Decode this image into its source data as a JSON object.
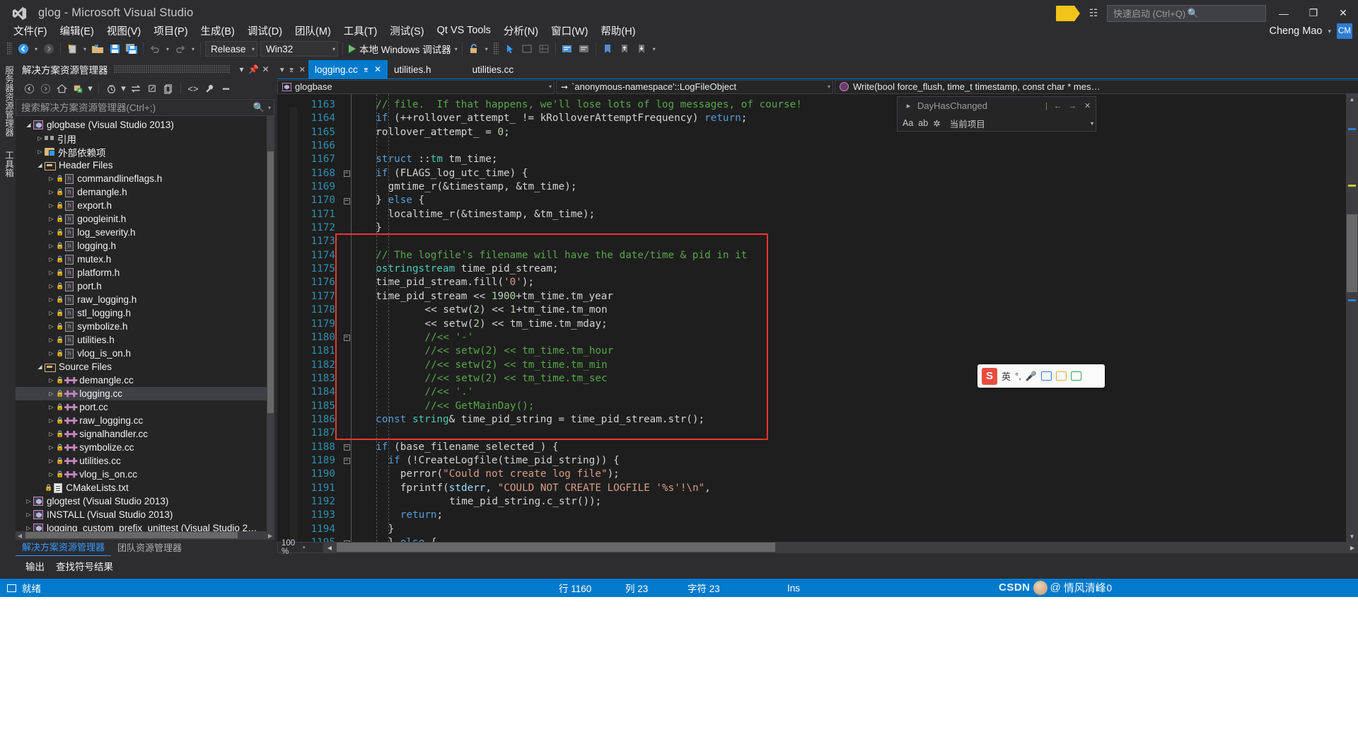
{
  "window": {
    "title": "glog - Microsoft Visual Studio",
    "logo_icon": "visual-studio-logo",
    "minimize_label": "—",
    "maximize_label": "❐",
    "close_label": "✕"
  },
  "titlebar_right": {
    "feedback_icon": "feedback-flag-icon",
    "notify_icon": "notification-icon",
    "quick_launch_placeholder": "快速启动 (Ctrl+Q)",
    "search_icon": "search-icon"
  },
  "menu": {
    "items": [
      "文件(F)",
      "编辑(E)",
      "视图(V)",
      "项目(P)",
      "生成(B)",
      "调试(D)",
      "团队(M)",
      "工具(T)",
      "测试(S)",
      "Qt VS Tools",
      "分析(N)",
      "窗口(W)",
      "帮助(H)"
    ],
    "user_name": "Cheng Mao",
    "user_initials": "CM",
    "user_caret": "▾"
  },
  "toolbar": {
    "nav_back_icon": "navigate-back-icon",
    "nav_forward_icon": "navigate-forward-icon",
    "new_project_icon": "new-project-icon",
    "open_file_icon": "open-file-icon",
    "save_icon": "save-icon",
    "save_all_icon": "save-all-icon",
    "undo_icon": "undo-icon",
    "redo_icon": "redo-icon",
    "configuration": "Release",
    "platform": "Win32",
    "run_label": "本地 Windows 调试器",
    "run_icon": "play-icon",
    "caret": "▾"
  },
  "vertical_tabs": [
    "服务器资源管理器",
    "工具箱"
  ],
  "solution_explorer": {
    "title": "解决方案资源管理器",
    "pin_icon": "pin-icon",
    "close_icon": "close-icon",
    "dropdown_icon": "chevron-down-icon",
    "toolbar_icons": [
      "back-icon",
      "forward-icon",
      "home-icon",
      "show-all-files-icon",
      "pending-changes-icon",
      "sync-icon",
      "collapse-all-icon",
      "properties-icon",
      "view-code-icon",
      "properties-wrench-icon",
      "preview-icon"
    ],
    "search_placeholder": "搜索解决方案资源管理器(Ctrl+;)",
    "search_icon": "search-icon",
    "tree": [
      {
        "depth": 0,
        "arrow": "expanded",
        "icon": "project-icon",
        "lock": false,
        "label": "glogbase (Visual Studio 2013)",
        "selected": false
      },
      {
        "depth": 1,
        "arrow": "collapsed",
        "icon": "references-icon",
        "lock": false,
        "label": "引用",
        "selected": false
      },
      {
        "depth": 1,
        "arrow": "collapsed",
        "icon": "external-deps-icon",
        "lock": false,
        "label": "外部依赖项",
        "selected": false
      },
      {
        "depth": 1,
        "arrow": "expanded",
        "icon": "filter-folder-icon",
        "lock": false,
        "label": "Header Files",
        "selected": false
      },
      {
        "depth": 2,
        "arrow": "collapsed",
        "icon": "header-file-icon",
        "lock": true,
        "label": "commandlineflags.h",
        "selected": false
      },
      {
        "depth": 2,
        "arrow": "collapsed",
        "icon": "header-file-icon",
        "lock": true,
        "label": "demangle.h",
        "selected": false
      },
      {
        "depth": 2,
        "arrow": "collapsed",
        "icon": "header-file-icon",
        "lock": true,
        "label": "export.h",
        "selected": false
      },
      {
        "depth": 2,
        "arrow": "collapsed",
        "icon": "header-file-icon",
        "lock": true,
        "label": "googleinit.h",
        "selected": false
      },
      {
        "depth": 2,
        "arrow": "collapsed",
        "icon": "header-file-icon",
        "lock": true,
        "label": "log_severity.h",
        "selected": false
      },
      {
        "depth": 2,
        "arrow": "collapsed",
        "icon": "header-file-icon",
        "lock": true,
        "label": "logging.h",
        "selected": false
      },
      {
        "depth": 2,
        "arrow": "collapsed",
        "icon": "header-file-icon",
        "lock": true,
        "label": "mutex.h",
        "selected": false
      },
      {
        "depth": 2,
        "arrow": "collapsed",
        "icon": "header-file-icon",
        "lock": true,
        "label": "platform.h",
        "selected": false
      },
      {
        "depth": 2,
        "arrow": "collapsed",
        "icon": "header-file-icon",
        "lock": true,
        "label": "port.h",
        "selected": false
      },
      {
        "depth": 2,
        "arrow": "collapsed",
        "icon": "header-file-icon",
        "lock": true,
        "label": "raw_logging.h",
        "selected": false
      },
      {
        "depth": 2,
        "arrow": "collapsed",
        "icon": "header-file-icon",
        "lock": true,
        "label": "stl_logging.h",
        "selected": false
      },
      {
        "depth": 2,
        "arrow": "collapsed",
        "icon": "header-file-icon",
        "lock": true,
        "label": "symbolize.h",
        "selected": false
      },
      {
        "depth": 2,
        "arrow": "collapsed",
        "icon": "header-file-icon",
        "lock": true,
        "label": "utilities.h",
        "selected": false
      },
      {
        "depth": 2,
        "arrow": "collapsed",
        "icon": "header-file-icon",
        "lock": true,
        "label": "vlog_is_on.h",
        "selected": false
      },
      {
        "depth": 1,
        "arrow": "expanded",
        "icon": "filter-folder-icon",
        "lock": false,
        "label": "Source Files",
        "selected": false
      },
      {
        "depth": 2,
        "arrow": "collapsed",
        "icon": "cpp-file-icon",
        "lock": true,
        "label": "demangle.cc",
        "selected": false
      },
      {
        "depth": 2,
        "arrow": "collapsed",
        "icon": "cpp-file-icon",
        "lock": true,
        "label": "logging.cc",
        "selected": true
      },
      {
        "depth": 2,
        "arrow": "collapsed",
        "icon": "cpp-file-icon",
        "lock": true,
        "label": "port.cc",
        "selected": false
      },
      {
        "depth": 2,
        "arrow": "collapsed",
        "icon": "cpp-file-icon",
        "lock": true,
        "label": "raw_logging.cc",
        "selected": false
      },
      {
        "depth": 2,
        "arrow": "collapsed",
        "icon": "cpp-file-icon",
        "lock": true,
        "label": "signalhandler.cc",
        "selected": false
      },
      {
        "depth": 2,
        "arrow": "collapsed",
        "icon": "cpp-file-icon",
        "lock": true,
        "label": "symbolize.cc",
        "selected": false
      },
      {
        "depth": 2,
        "arrow": "collapsed",
        "icon": "cpp-file-icon",
        "lock": true,
        "label": "utilities.cc",
        "selected": false
      },
      {
        "depth": 2,
        "arrow": "collapsed",
        "icon": "cpp-file-icon",
        "lock": true,
        "label": "vlog_is_on.cc",
        "selected": false
      },
      {
        "depth": 1,
        "arrow": "none",
        "icon": "text-file-icon",
        "lock": true,
        "label": "CMakeLists.txt",
        "selected": false
      },
      {
        "depth": 0,
        "arrow": "collapsed",
        "icon": "project-icon",
        "lock": false,
        "label": "glogtest (Visual Studio 2013)",
        "selected": false
      },
      {
        "depth": 0,
        "arrow": "collapsed",
        "icon": "project-icon",
        "lock": false,
        "label": "INSTALL (Visual Studio 2013)",
        "selected": false
      },
      {
        "depth": 0,
        "arrow": "collapsed",
        "icon": "project-icon",
        "lock": false,
        "label": "logging_custom_prefix_unittest (Visual Studio 2…",
        "selected": false
      }
    ],
    "panel_tabs": [
      {
        "label": "解决方案资源管理器",
        "active": true
      },
      {
        "label": "团队资源管理器",
        "active": false
      }
    ]
  },
  "editor": {
    "tabs": [
      {
        "label": "logging.cc",
        "active": true,
        "pin_icon": "pin-icon",
        "close_icon": "close-icon"
      },
      {
        "label": "utilities.h",
        "active": false
      },
      {
        "label": "utilities.cc",
        "active": false
      }
    ],
    "navbar": {
      "project": "glogbase",
      "project_icon": "project-icon",
      "scope": "`anonymous-namespace'::LogFileObject",
      "scope_arrow_icon": "arrow-right-icon",
      "member": "Write(bool force_flush, time_t timestamp, const char * mes…",
      "member_icon": "method-icon",
      "caret": "▾"
    },
    "zoom": "100 %",
    "zoom_caret": "▾",
    "first_line": 1163,
    "lines": [
      {
        "n": 1163,
        "fold": "",
        "indent": 1,
        "tokens": [
          [
            "c",
            "// file.  If that happens, we'll lose lots of log messages, of course!"
          ]
        ]
      },
      {
        "n": 1164,
        "fold": "",
        "indent": 1,
        "tokens": [
          [
            "k",
            "if"
          ],
          [
            "p",
            " (++rollover_attempt_ != kRolloverAttemptFrequency) "
          ],
          [
            "k",
            "return"
          ],
          [
            "p",
            ";"
          ]
        ]
      },
      {
        "n": 1165,
        "fold": "",
        "indent": 1,
        "tokens": [
          [
            "p",
            "rollover_attempt_ = "
          ],
          [
            "n",
            "0"
          ],
          [
            "p",
            ";"
          ]
        ]
      },
      {
        "n": 1166,
        "fold": "",
        "indent": 1,
        "tokens": []
      },
      {
        "n": 1167,
        "fold": "",
        "indent": 1,
        "tokens": [
          [
            "k",
            "struct"
          ],
          [
            "p",
            " ::"
          ],
          [
            "t",
            "tm"
          ],
          [
            "p",
            " tm_time;"
          ]
        ]
      },
      {
        "n": 1168,
        "fold": "minus",
        "indent": 1,
        "tokens": [
          [
            "k",
            "if"
          ],
          [
            "p",
            " (FLAGS_log_utc_time) {"
          ]
        ]
      },
      {
        "n": 1169,
        "fold": "",
        "indent": 2,
        "tokens": [
          [
            "p",
            "gmtime_r(&timestamp, &tm_time);"
          ]
        ]
      },
      {
        "n": 1170,
        "fold": "minus",
        "indent": 1,
        "tokens": [
          [
            "p",
            "} "
          ],
          [
            "k",
            "else"
          ],
          [
            "p",
            " {"
          ]
        ]
      },
      {
        "n": 1171,
        "fold": "",
        "indent": 2,
        "tokens": [
          [
            "p",
            "localtime_r(&timestamp, &tm_time);"
          ]
        ]
      },
      {
        "n": 1172,
        "fold": "",
        "indent": 1,
        "tokens": [
          [
            "p",
            "}"
          ]
        ]
      },
      {
        "n": 1173,
        "fold": "",
        "indent": 1,
        "tokens": []
      },
      {
        "n": 1174,
        "fold": "",
        "indent": 1,
        "tokens": [
          [
            "c",
            "// The logfile's filename will have the date/time & pid in it"
          ]
        ]
      },
      {
        "n": 1175,
        "fold": "",
        "indent": 1,
        "tokens": [
          [
            "t",
            "ostringstream"
          ],
          [
            "p",
            " time_pid_stream;"
          ]
        ]
      },
      {
        "n": 1176,
        "fold": "",
        "indent": 1,
        "tokens": [
          [
            "p",
            "time_pid_stream.fill("
          ],
          [
            "s",
            "'0'"
          ],
          [
            "p",
            ");"
          ]
        ]
      },
      {
        "n": 1177,
        "fold": "",
        "indent": 1,
        "tokens": [
          [
            "p",
            "time_pid_stream << "
          ],
          [
            "n",
            "1900"
          ],
          [
            "p",
            "+tm_time.tm_year"
          ]
        ]
      },
      {
        "n": 1178,
        "fold": "",
        "indent": 5,
        "tokens": [
          [
            "p",
            "<< setw("
          ],
          [
            "n",
            "2"
          ],
          [
            "p",
            ") << "
          ],
          [
            "n",
            "1"
          ],
          [
            "p",
            "+tm_time.tm_mon"
          ]
        ]
      },
      {
        "n": 1179,
        "fold": "",
        "indent": 5,
        "tokens": [
          [
            "p",
            "<< setw("
          ],
          [
            "n",
            "2"
          ],
          [
            "p",
            ") << tm_time.tm_mday;"
          ]
        ]
      },
      {
        "n": 1180,
        "fold": "minus",
        "indent": 5,
        "tokens": [
          [
            "c",
            "//<< '-'"
          ]
        ]
      },
      {
        "n": 1181,
        "fold": "",
        "indent": 5,
        "tokens": [
          [
            "c",
            "//<< setw(2) << tm_time.tm_hour"
          ]
        ]
      },
      {
        "n": 1182,
        "fold": "",
        "indent": 5,
        "tokens": [
          [
            "c",
            "//<< setw(2) << tm_time.tm_min"
          ]
        ]
      },
      {
        "n": 1183,
        "fold": "",
        "indent": 5,
        "tokens": [
          [
            "c",
            "//<< setw(2) << tm_time.tm_sec"
          ]
        ]
      },
      {
        "n": 1184,
        "fold": "",
        "indent": 5,
        "tokens": [
          [
            "c",
            "//<< '.'"
          ]
        ]
      },
      {
        "n": 1185,
        "fold": "",
        "indent": 5,
        "tokens": [
          [
            "c",
            "//<< GetMainDay();"
          ]
        ]
      },
      {
        "n": 1186,
        "fold": "",
        "indent": 1,
        "tokens": [
          [
            "k",
            "const"
          ],
          [
            "p",
            " "
          ],
          [
            "t",
            "string"
          ],
          [
            "p",
            "& time_pid_string = time_pid_stream.str();"
          ]
        ]
      },
      {
        "n": 1187,
        "fold": "",
        "indent": 1,
        "tokens": []
      },
      {
        "n": 1188,
        "fold": "minus",
        "indent": 1,
        "tokens": [
          [
            "k",
            "if"
          ],
          [
            "p",
            " (base_filename_selected_) {"
          ]
        ]
      },
      {
        "n": 1189,
        "fold": "minus",
        "indent": 2,
        "tokens": [
          [
            "k",
            "if"
          ],
          [
            "p",
            " (!CreateLogfile(time_pid_string)) {"
          ]
        ]
      },
      {
        "n": 1190,
        "fold": "",
        "indent": 3,
        "tokens": [
          [
            "p",
            "perror("
          ],
          [
            "s",
            "\"Could not create log file\""
          ],
          [
            "p",
            ");"
          ]
        ]
      },
      {
        "n": 1191,
        "fold": "",
        "indent": 3,
        "tokens": [
          [
            "p",
            "fprintf("
          ],
          [
            "id",
            "stderr"
          ],
          [
            "p",
            ", "
          ],
          [
            "s",
            "\"COULD NOT CREATE LOGFILE '%s'!\\n\""
          ],
          [
            "p",
            ","
          ]
        ]
      },
      {
        "n": 1192,
        "fold": "",
        "indent": 7,
        "tokens": [
          [
            "p",
            "time_pid_string.c_str());"
          ]
        ]
      },
      {
        "n": 1193,
        "fold": "",
        "indent": 3,
        "tokens": [
          [
            "k",
            "return"
          ],
          [
            "p",
            ";"
          ]
        ]
      },
      {
        "n": 1194,
        "fold": "",
        "indent": 2,
        "tokens": [
          [
            "p",
            "}"
          ]
        ]
      },
      {
        "n": 1195,
        "fold": "minus",
        "indent": 2,
        "tokens": [
          [
            "p",
            "} "
          ],
          [
            "k",
            "else"
          ],
          [
            "p",
            " {"
          ]
        ]
      }
    ],
    "annotation": {
      "type": "red-rectangle",
      "from_line": 1173,
      "to_line": 1187,
      "color": "#f0352f"
    }
  },
  "find_panel": {
    "query": "DayHasChanged",
    "prev_icon": "chevron-up-icon",
    "next_icon": "chevron-down-icon",
    "close_icon": "close-icon",
    "expand_icon": "chevron-right-icon",
    "match_case": "Aa",
    "match_word": "ab",
    "regex": "✲",
    "scope": "当前项目",
    "scope_caret": "▾",
    "separator": "|"
  },
  "bottom_panel_tabs": [
    "输出",
    "查找符号结果"
  ],
  "statusbar": {
    "ready": "就绪",
    "ready_icon": "ready-icon",
    "line_label": "行 1160",
    "col_label": "列 23",
    "char_label": "字符 23",
    "insert_mode": "Ins",
    "up_icon": "↑",
    "up_count": "0",
    "background": "#007acc"
  },
  "ime_bar": {
    "logo": "S",
    "mode": "英",
    "items": [
      "punctuation-icon",
      "mic-icon",
      "keyboard-icon",
      "toolbox-icon",
      "apps-icon"
    ]
  },
  "watermark": {
    "site": "CSDN",
    "at": "@",
    "user": "情风清峰",
    "avatar_icon": "avatar-icon"
  }
}
